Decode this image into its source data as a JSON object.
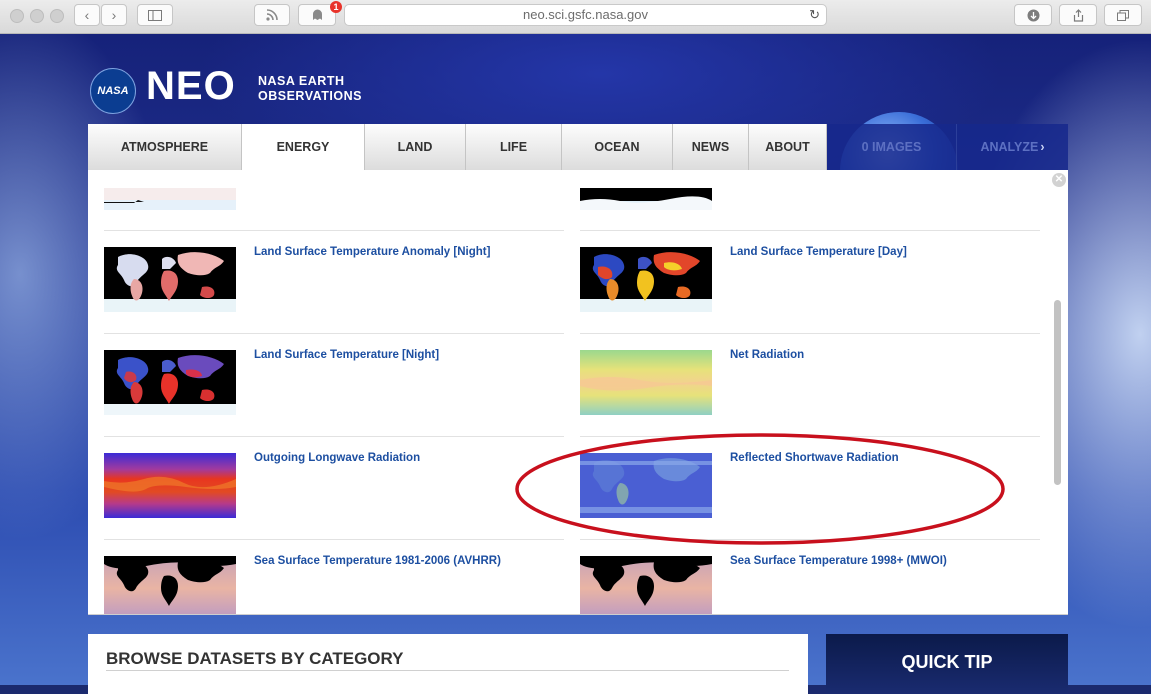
{
  "browser": {
    "url": "neo.sci.gsfc.nasa.gov",
    "notification_count": "1"
  },
  "header": {
    "nasa_logo_text": "NASA",
    "logo_text": "NEO",
    "tagline_line1": "NASA EARTH",
    "tagline_line2": "OBSERVATIONS"
  },
  "nav": {
    "tabs": [
      {
        "label": "ATMOSPHERE"
      },
      {
        "label": "ENERGY"
      },
      {
        "label": "LAND"
      },
      {
        "label": "LIFE"
      },
      {
        "label": "OCEAN"
      },
      {
        "label": "NEWS"
      },
      {
        "label": "ABOUT"
      },
      {
        "label": "0 IMAGES"
      },
      {
        "label": "ANALYZE"
      }
    ],
    "active_tab": "ENERGY"
  },
  "datasets": {
    "items": [
      {
        "title": "Land Surface Temperature Anomaly [Night]",
        "map_style": "anomaly"
      },
      {
        "title": "Land Surface Temperature [Day]",
        "map_style": "lst-day"
      },
      {
        "title": "Land Surface Temperature [Night]",
        "map_style": "lst-night"
      },
      {
        "title": "Net Radiation",
        "map_style": "net-radiation"
      },
      {
        "title": "Outgoing Longwave Radiation",
        "map_style": "longwave"
      },
      {
        "title": "Reflected Shortwave Radiation",
        "map_style": "shortwave",
        "highlighted": true
      },
      {
        "title": "Sea Surface Temperature 1981-2006 (AVHRR)",
        "map_style": "sst"
      },
      {
        "title": "Sea Surface Temperature 1998+ (MWOI)",
        "map_style": "sst"
      }
    ],
    "highlight_color": "#c8101d"
  },
  "browse": {
    "title": "BROWSE DATASETS BY CATEGORY"
  },
  "quick_tip": {
    "title": "QUICK TIP"
  }
}
